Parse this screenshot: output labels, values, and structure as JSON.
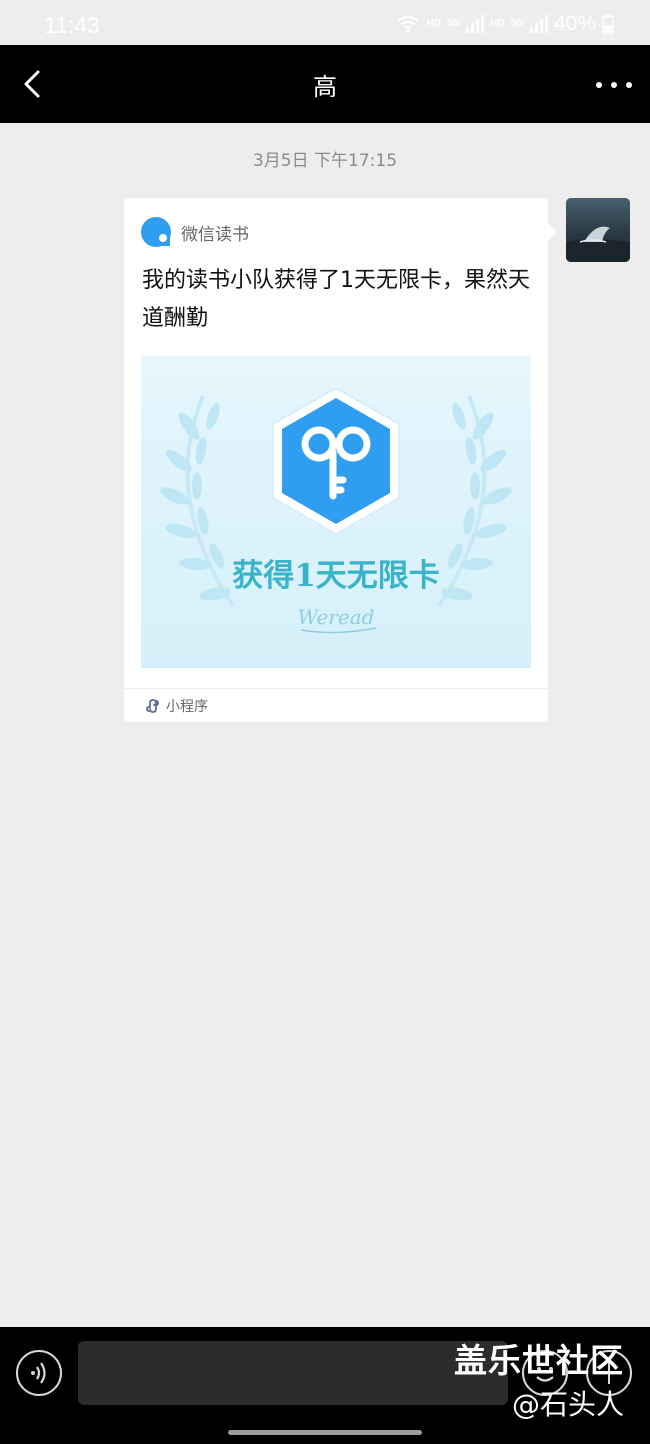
{
  "status_bar": {
    "time": "11:43",
    "network_1": "HD",
    "network_1_type": "5G",
    "network_2": "HD",
    "network_2_type": "5G",
    "battery": "40%"
  },
  "header": {
    "title": "高",
    "back_icon": "chevron-left-icon",
    "more_icon": "more-horizontal-icon"
  },
  "chat": {
    "timestamp": "3月5日 下午17:15",
    "message": {
      "source_name": "微信读书",
      "title": "我的读书小队获得了1天无限卡，果然天道酬勤",
      "image_text": "获得1天无限卡",
      "image_signature": "Weread",
      "footer_label": "小程序"
    }
  },
  "bottom_bar": {
    "voice_icon": "voice-icon",
    "emoji_icon": "emoji-icon",
    "plus_icon": "plus-icon",
    "input_value": ""
  },
  "watermark": {
    "main": "盖乐世社区",
    "sub": "@石头人"
  },
  "colors": {
    "background": "#ededed",
    "header": "#000000",
    "accent_blue": "#2f9ef0",
    "card": "#ffffff"
  }
}
